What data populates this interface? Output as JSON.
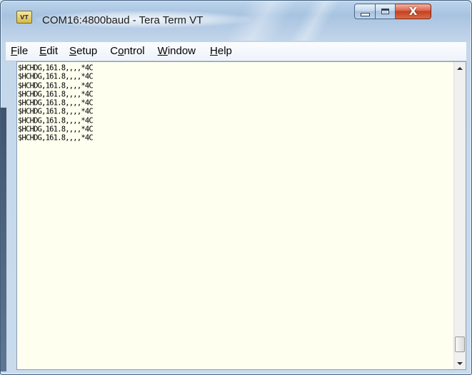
{
  "window": {
    "title": "COM16:4800baud - Tera Term VT",
    "icon_label": "VT"
  },
  "menu": {
    "items": [
      {
        "mnemonic": "F",
        "rest": "ile"
      },
      {
        "mnemonic": "E",
        "rest": "dit"
      },
      {
        "mnemonic": "S",
        "rest": "etup"
      },
      {
        "pre": "C",
        "mnemonic": "o",
        "rest": "ntrol"
      },
      {
        "mnemonic": "W",
        "rest": "indow"
      },
      {
        "mnemonic": "H",
        "rest": "elp"
      }
    ]
  },
  "terminal": {
    "lines": [
      "$HCHDG,161.8,,,,*4C",
      "$HCHDG,161.8,,,,*4C",
      "$HCHDG,161.8,,,,*4C",
      "$HCHDG,161.8,,,,*4C",
      "$HCHDG,161.8,,,,*4C",
      "$HCHDG,161.8,,,,*4C",
      "$HCHDG,161.8,,,,*4C",
      "$HCHDG,161.8,,,,*4C",
      "$HCHDG,161.8,,,,*4C"
    ],
    "background": "#fffff0",
    "foreground": "#000000"
  },
  "caption_buttons": {
    "minimize_icon": "minimize-icon",
    "maximize_icon": "maximize-icon",
    "close_icon": "close-icon",
    "close_glyph": "X"
  },
  "scrollbar": {
    "up_icon": "scroll-up-arrow-icon",
    "down_icon": "scroll-down-arrow-icon",
    "position": 1.0
  }
}
